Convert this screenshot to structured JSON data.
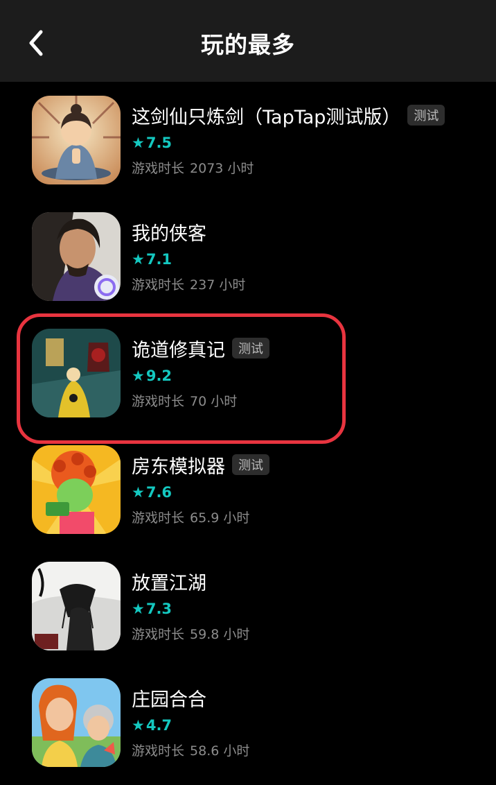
{
  "header": {
    "title": "玩的最多",
    "back_icon": "chevron-left-icon"
  },
  "games": [
    {
      "name": "这剑仙只炼剑（TapTap测试版）",
      "tag": "测试",
      "rating": "7.5",
      "hours_label": "游戏时长",
      "hours_value": "2073 小时"
    },
    {
      "name": "我的侠客",
      "tag": "",
      "rating": "7.1",
      "hours_label": "游戏时长",
      "hours_value": "237 小时"
    },
    {
      "name": "诡道修真记",
      "tag": "测试",
      "rating": "9.2",
      "hours_label": "游戏时长",
      "hours_value": "70 小时"
    },
    {
      "name": "房东模拟器",
      "tag": "测试",
      "rating": "7.6",
      "hours_label": "游戏时长",
      "hours_value": "65.9 小时"
    },
    {
      "name": "放置江湖",
      "tag": "",
      "rating": "7.3",
      "hours_label": "游戏时长",
      "hours_value": "59.8 小时"
    },
    {
      "name": "庄园合合",
      "tag": "",
      "rating": "4.7",
      "hours_label": "游戏时长",
      "hours_value": "58.6 小时"
    }
  ],
  "colors": {
    "accent": "#14c8c0",
    "highlight": "#e8343f",
    "header_bg": "#1c1c1c"
  }
}
